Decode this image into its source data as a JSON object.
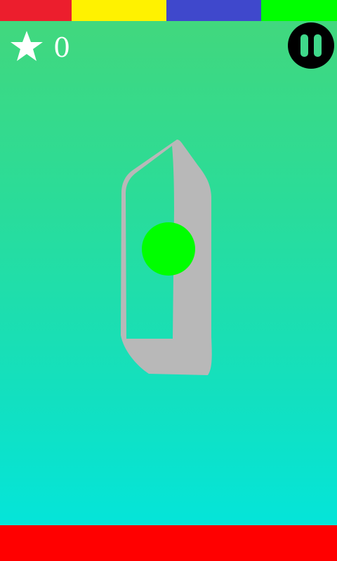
{
  "top_strip": {
    "segments": [
      {
        "name": "red",
        "color": "#ec1e2d"
      },
      {
        "name": "yellow",
        "color": "#fff200"
      },
      {
        "name": "blue",
        "color": "#3f48cc"
      },
      {
        "name": "green",
        "color": "#00ff00"
      }
    ]
  },
  "score": {
    "icon": "star-icon",
    "value": "0"
  },
  "pause": {
    "icon": "pause-icon"
  },
  "obstacle": {
    "color": "#b8b8b8"
  },
  "ball": {
    "color": "#00ff00"
  },
  "bottom_bar": {
    "color": "#ff0000"
  },
  "background": {
    "top_color": "#44d77a",
    "bottom_color": "#00e6e0"
  }
}
